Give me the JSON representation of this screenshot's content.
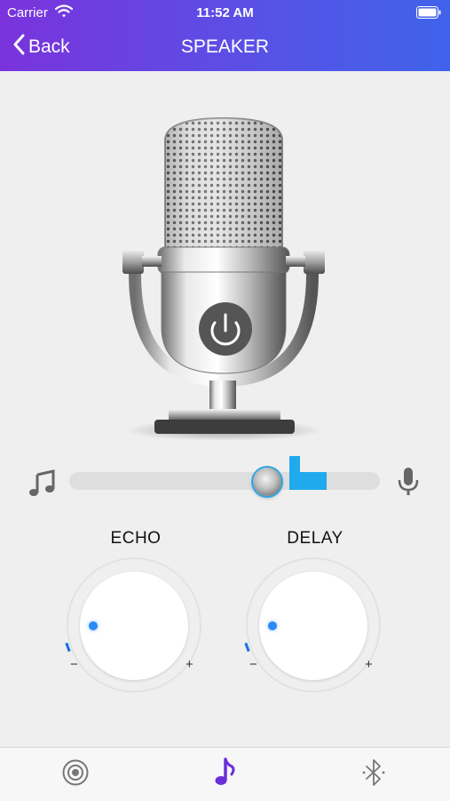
{
  "status_bar": {
    "carrier": "Carrier",
    "time": "11:52 AM"
  },
  "nav": {
    "back_label": "Back",
    "title": "SPEAKER"
  },
  "slider": {
    "value_fraction": 0.62
  },
  "knobs": [
    {
      "label": "ECHO",
      "minus": "−",
      "plus": "+"
    },
    {
      "label": "DELAY",
      "minus": "−",
      "plus": "+"
    }
  ],
  "tabs": [
    {
      "icon": "target-icon"
    },
    {
      "icon": "music-note-icon",
      "active": true
    },
    {
      "icon": "bluetooth-icon"
    }
  ],
  "colors": {
    "header_start": "#7a33dc",
    "header_end": "#3f63ea",
    "accent_blue": "#2aa7e6",
    "tab_active": "#6a2fd8"
  }
}
